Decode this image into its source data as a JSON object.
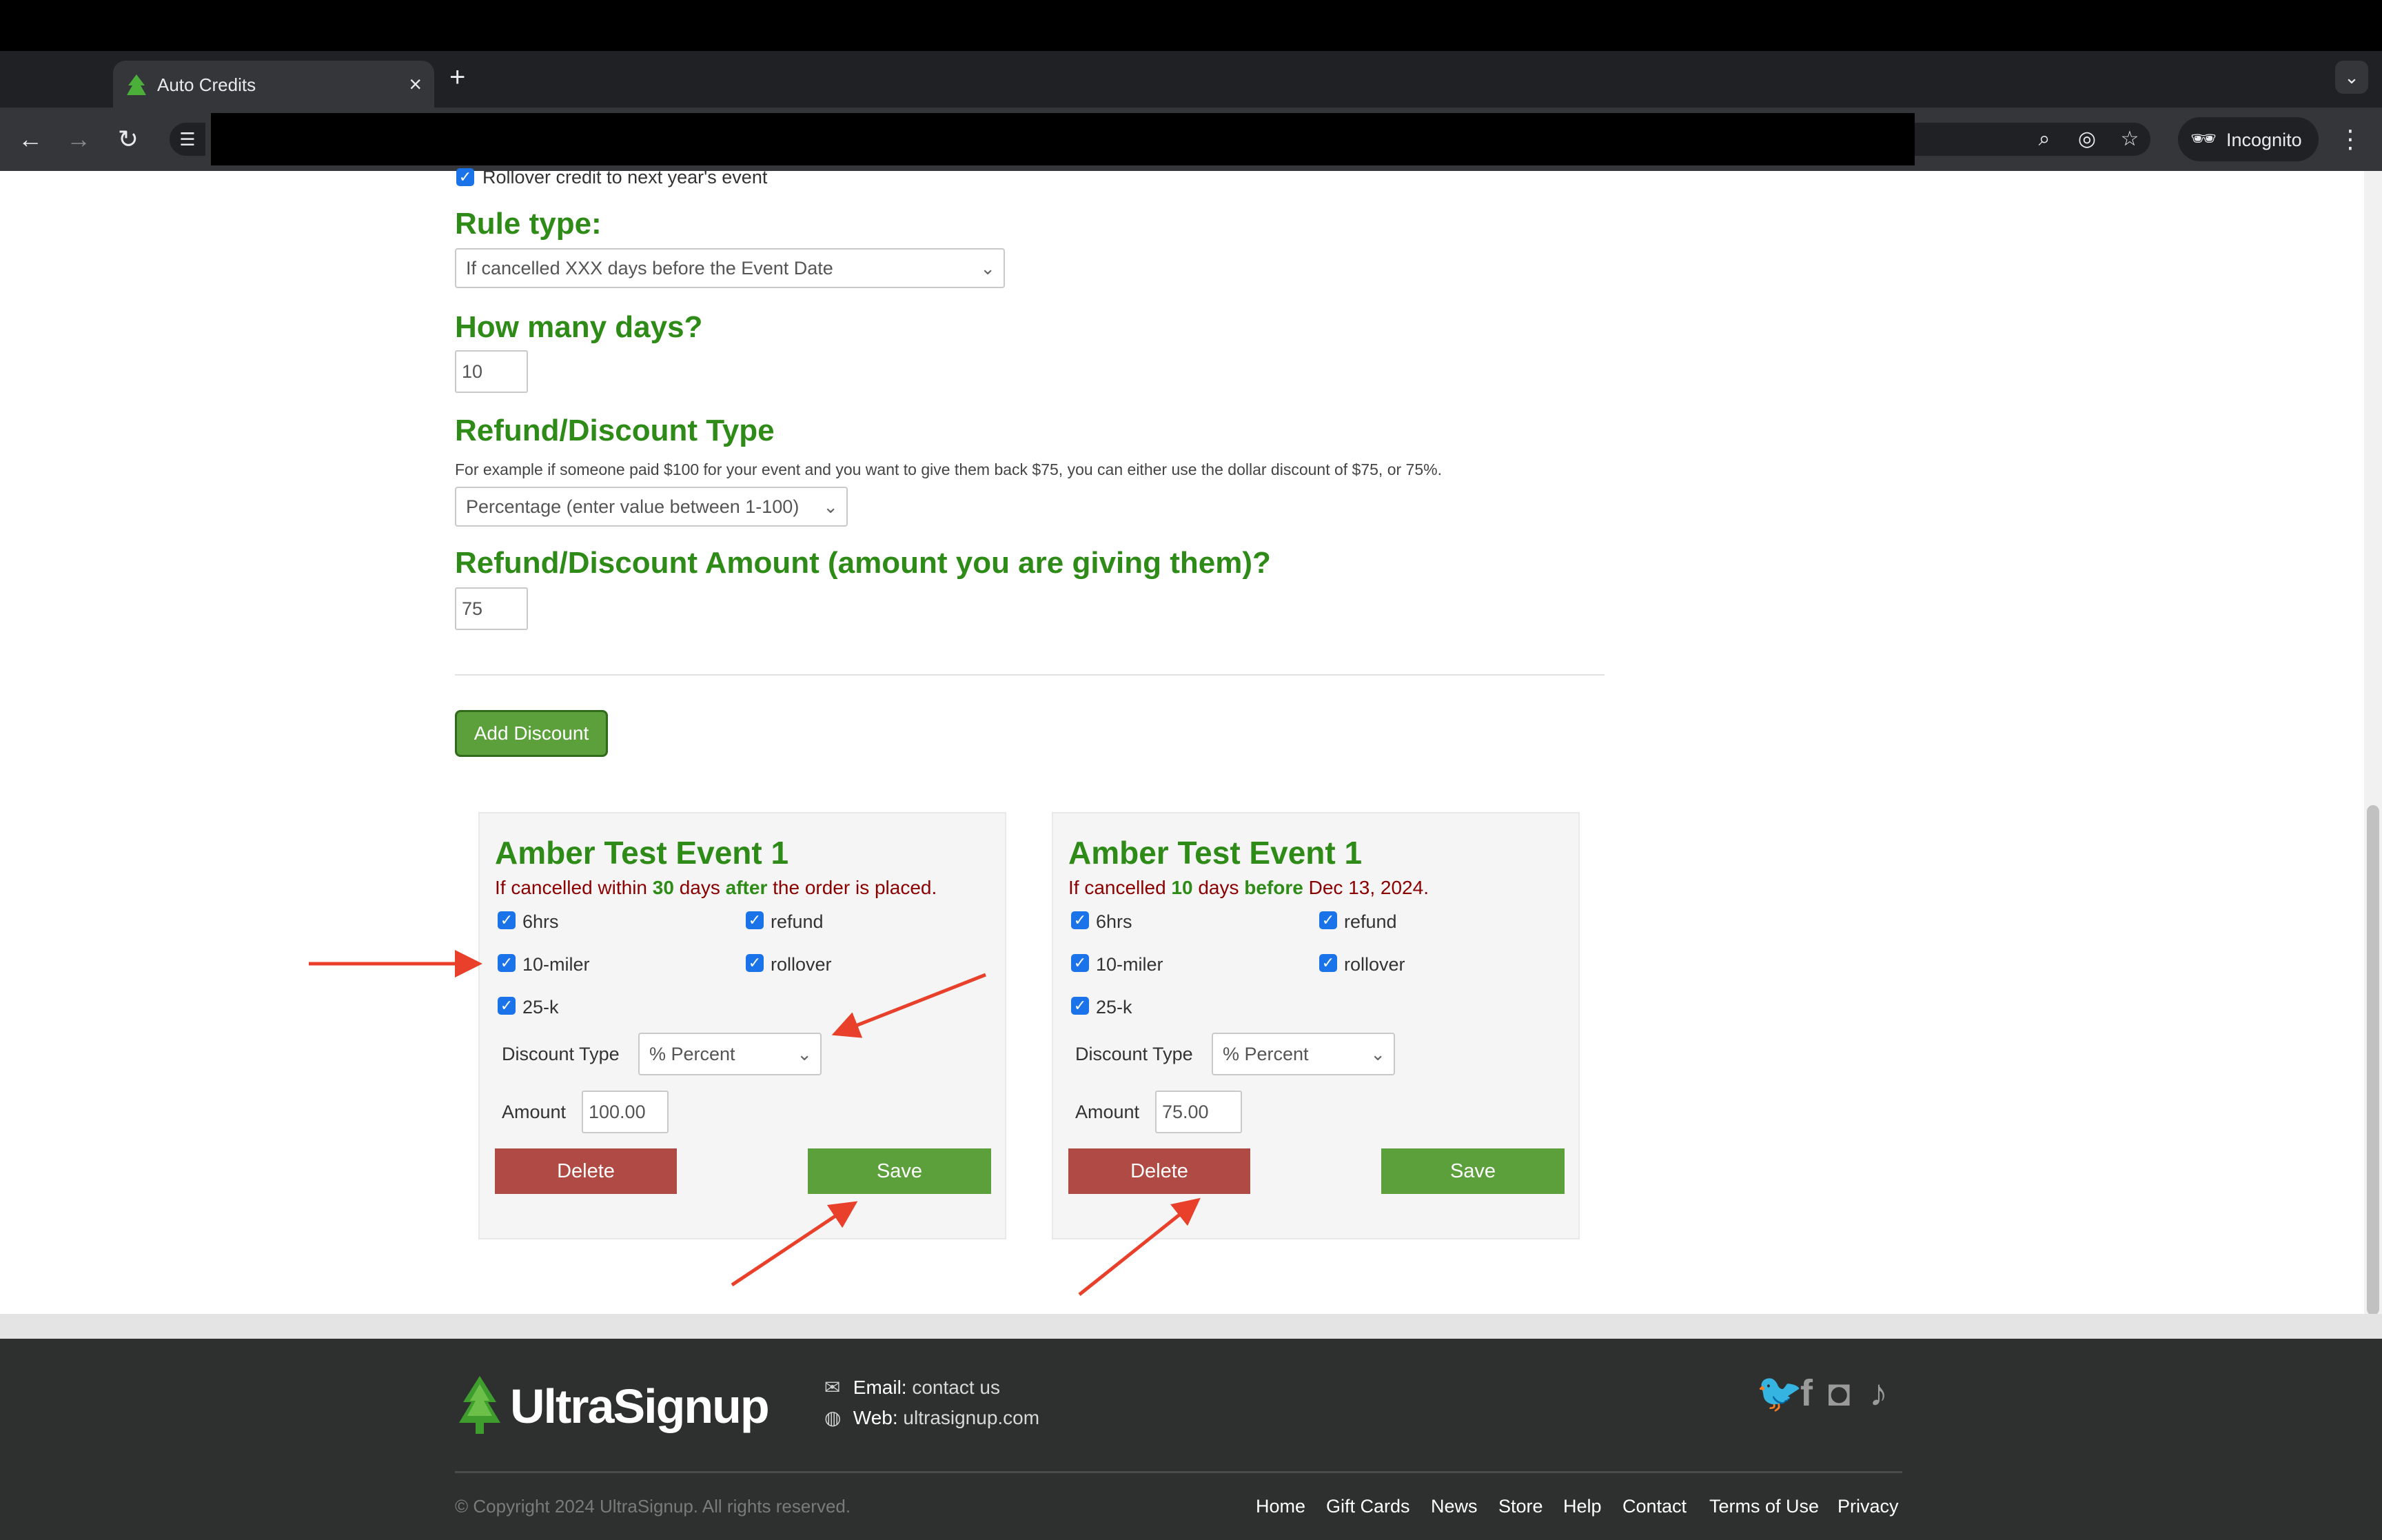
{
  "browser": {
    "tab_title": "Auto Credits",
    "tab_close": "×",
    "new_tab": "+",
    "incognito_label": "Incognito"
  },
  "form": {
    "rollover_label": "Rollover credit to next year's event",
    "rule_type_heading": "Rule type:",
    "rule_type_value": "If cancelled XXX days before the Event Date",
    "days_heading": "How many days?",
    "days_value": "10",
    "refund_type_heading": "Refund/Discount Type",
    "refund_type_hint": "For example if someone paid $100 for your event and you want to give them back $75, you can either use the dollar discount of $75, or 75%.",
    "refund_type_value": "Percentage (enter value between 1-100)",
    "amount_heading": "Refund/Discount Amount (amount you are giving them)?",
    "amount_value": "75",
    "add_button": "Add Discount"
  },
  "cards": [
    {
      "title": "Amber Test Event 1",
      "rule_prefix": "If cancelled within ",
      "rule_days": "30",
      "rule_mid": " days ",
      "rule_keyword": "after",
      "rule_suffix": " the order is placed.",
      "options": [
        "6hrs",
        "refund",
        "10-miler",
        "rollover",
        "25-k"
      ],
      "discount_type_label": "Discount Type",
      "discount_type_value": "% Percent",
      "amount_label": "Amount",
      "amount_value": "100.00",
      "delete_label": "Delete",
      "save_label": "Save"
    },
    {
      "title": "Amber Test Event 1",
      "rule_prefix": "If cancelled ",
      "rule_days": "10",
      "rule_mid": " days ",
      "rule_keyword": "before",
      "rule_suffix": " Dec 13, 2024.",
      "options": [
        "6hrs",
        "refund",
        "10-miler",
        "rollover",
        "25-k"
      ],
      "discount_type_label": "Discount Type",
      "discount_type_value": "% Percent",
      "amount_label": "Amount",
      "amount_value": "75.00",
      "delete_label": "Delete",
      "save_label": "Save"
    }
  ],
  "footer": {
    "brand": "UltraSignup",
    "email_label": "Email:",
    "email_value": "contact us",
    "web_label": "Web:",
    "web_value": "ultrasignup.com",
    "copyright": "© Copyright 2024 UltraSignup. All rights reserved.",
    "links": [
      "Home",
      "Gift Cards",
      "News",
      "Store",
      "Help",
      "Contact",
      "Terms of Use",
      "Privacy"
    ]
  },
  "colors": {
    "heading_green": "#2e8b17",
    "rule_red": "#8b0000",
    "save_green": "#5ca03c",
    "delete_red": "#b04a44",
    "annotation_arrow": "#e8402a"
  }
}
